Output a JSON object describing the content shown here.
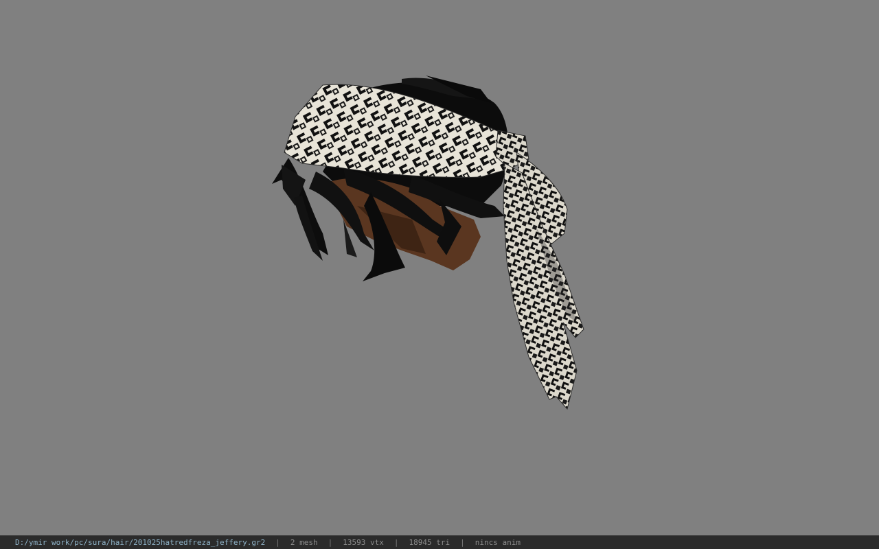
{
  "viewer": {
    "background_color": "#808080",
    "model": "hair mesh with patterned headscarf"
  },
  "status_bar": {
    "file_path": "D:/ymir work/pc/sura/hair/201025hatredfreza_jeffery.gr2",
    "separator": "|",
    "mesh_count": "2 mesh",
    "vertex_count": "13593 vtx",
    "triangle_count": "18945 tri",
    "animation": "nincs anim"
  }
}
